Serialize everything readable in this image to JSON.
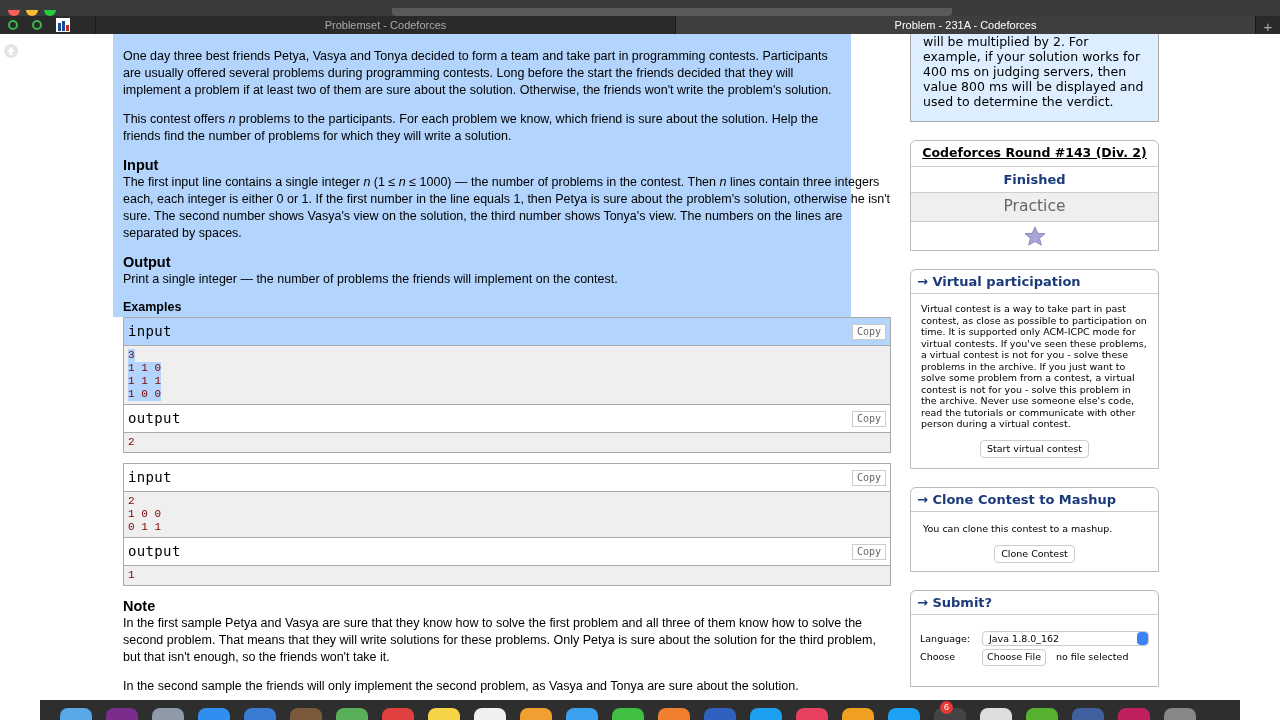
{
  "browser": {
    "tabs": [
      {
        "title": "Problemset - Codeforces",
        "selected": false
      },
      {
        "title": "Problem - 231A - Codeforces",
        "selected": true
      }
    ],
    "new_tab": "+"
  },
  "statement": [
    {
      "kind": "paragraph",
      "text": "One day three best friends Petya, Vasya and Tonya decided to form a team and take part in programming contests. Participants are usually offered several problems during programming contests. Long before the start the friends decided that they will implement a problem if at least two of them are sure about the solution. Otherwise, the friends won't write the problem's solution.",
      "selected": true
    },
    {
      "kind": "paragraph",
      "text": "This contest offers *n* problems to the participants. For each problem we know, which friend is sure about the solution. Help the friends find the number of problems for which they will write a solution.",
      "selected": true
    },
    {
      "kind": "heading",
      "text": "Input",
      "selected": true
    },
    {
      "kind": "text",
      "text": "The first input line contains a single integer *n* (1 ≤ *n* ≤ 1000) — the number of problems in the contest. Then *n* lines contain three integers each, each integer is either 0 or 1. If the first number in the line equals 1, then Petya is sure about the problem's solution, otherwise he isn't sure. The second number shows Vasya's view on the solution, the third number shows Tonya's view. The numbers on the lines are separated by spaces.",
      "selected": true
    },
    {
      "kind": "heading",
      "text": "Output",
      "selected": true
    },
    {
      "kind": "text",
      "text": "Print a single integer — the number of problems the friends will implement on the contest.",
      "selected": true
    }
  ],
  "examples": {
    "title": "Examples",
    "selected": true,
    "tests": [
      {
        "input_label": "input",
        "input_copy": "Copy",
        "input_lines": [
          "3",
          "1 1 0",
          "1 1 1",
          "1 0 0"
        ],
        "input_selected": true,
        "output_label": "output",
        "output_copy": "Copy",
        "output_lines": [
          "2"
        ]
      },
      {
        "input_label": "input",
        "input_copy": "Copy",
        "input_lines": [
          "2",
          "1 0 0",
          "0 1 1"
        ],
        "input_selected": false,
        "output_label": "output",
        "output_copy": "Copy",
        "output_lines": [
          "1"
        ]
      }
    ]
  },
  "note": {
    "title": "Note",
    "paragraphs": [
      "In the first sample Petya and Vasya are sure that they know how to solve the first problem and all three of them know how to solve the second problem. That means that they will write solutions for these problems. Only Petya is sure about the solution for the third problem, but that isn't enough, so the friends won't take it.",
      "In the second sample the friends will only implement the second problem, as Vasya and Tonya are sure about the solution."
    ]
  },
  "sidebar": {
    "limit_note": "will be multiplied by 2. For example, if your solution works for 400 ms on judging servers, then value 800 ms will be displayed and used to determine the verdict.",
    "round": {
      "title": "Codeforces Round #143 (Div. 2)",
      "status": "Finished",
      "mode": "Practice",
      "favorite": true
    },
    "virtual": {
      "title": "→ Virtual participation",
      "text": "Virtual contest is a way to take part in past contest, as close as possible to participation on time. It is supported only ACM-ICPC mode for virtual contests. If you've seen these problems, a virtual contest is not for you - solve these problems in the archive. If you just want to solve some problem from a contest, a virtual contest is not for you - solve this problem in the archive. Never use someone else's code, read the tutorials or communicate with other person during a virtual contest.",
      "button": "Start virtual contest"
    },
    "clone": {
      "title": "→ Clone Contest to Mashup",
      "text": "You can clone this contest to a mashup.",
      "button": "Clone Contest"
    },
    "submit": {
      "title": "→ Submit?",
      "language_label": "Language:",
      "language": "Java 1.8.0_162",
      "choose_label": "Choose",
      "file_button": "Choose File",
      "file_status": "no file selected"
    }
  },
  "dock": {
    "badge": "6"
  }
}
